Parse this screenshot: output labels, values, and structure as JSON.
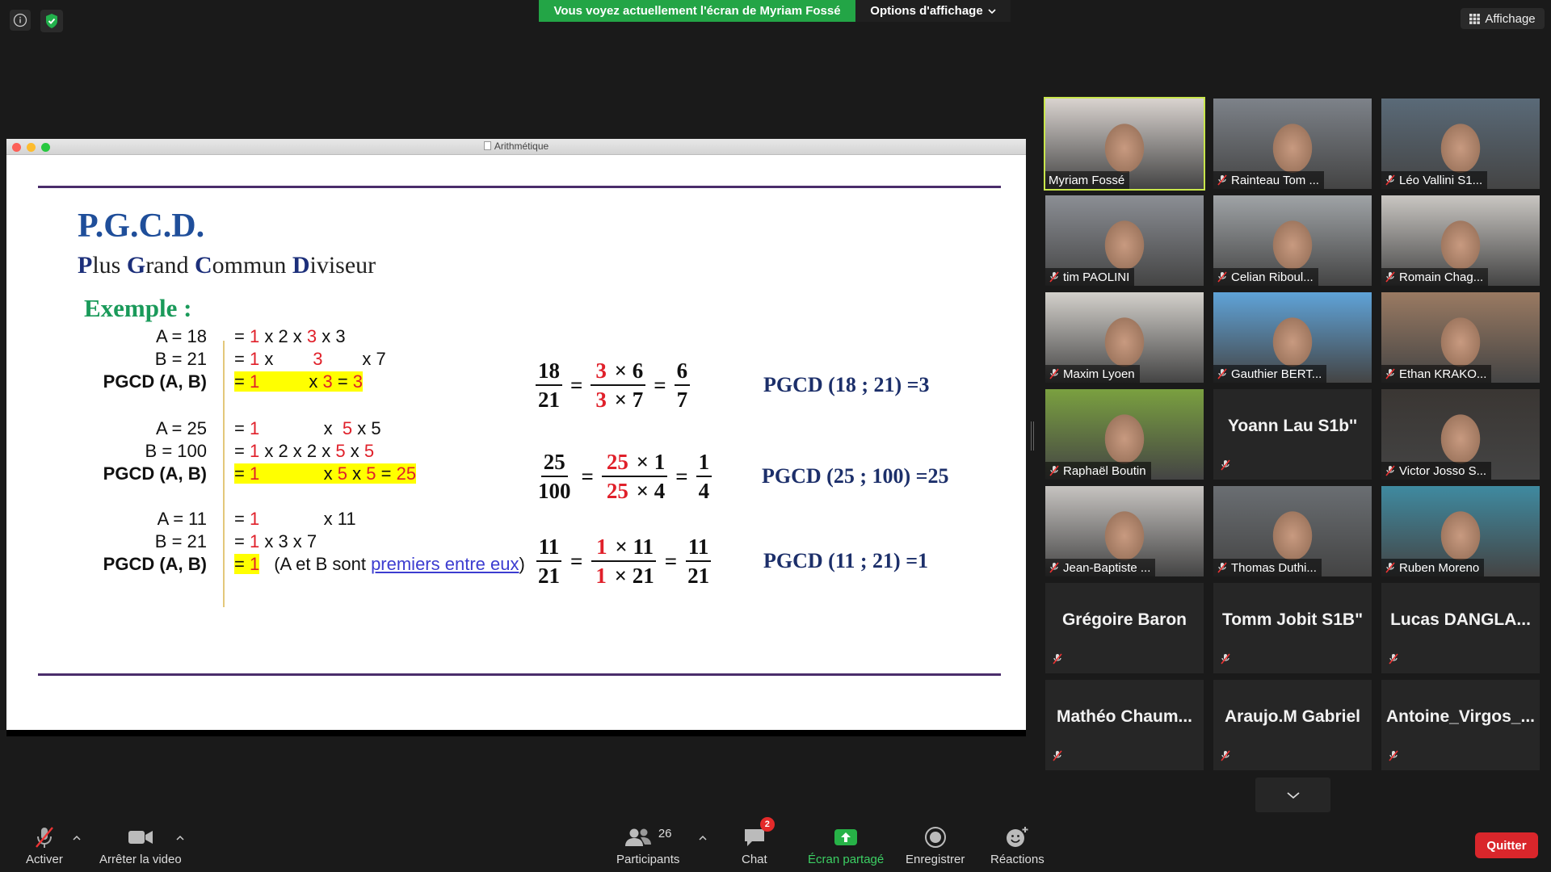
{
  "banner": {
    "text": "Vous voyez actuellement l'écran de Myriam Fossé",
    "options": "Options d'affichage"
  },
  "affichage": "Affichage",
  "window": {
    "title": "Arithmétique"
  },
  "slide": {
    "title": "P.G.C.D.",
    "subtitle": [
      "P",
      "lus ",
      "G",
      "rand ",
      "C",
      "ommun ",
      "D",
      "iviseur"
    ],
    "example": "Exemple :",
    "examples": [
      {
        "rows": [
          {
            "left": "A = 18",
            "mid": [
              [
                "= ",
                ""
              ],
              [
                "1",
                "red"
              ],
              [
                " x 2 x ",
                ""
              ],
              [
                "3",
                "red"
              ],
              [
                " x 3",
                ""
              ]
            ]
          },
          {
            "left": "B = 21",
            "mid": [
              [
                "= ",
                ""
              ],
              [
                "1",
                "red"
              ],
              [
                " x        ",
                ""
              ],
              [
                "3",
                "red"
              ],
              [
                "        x 7",
                ""
              ]
            ]
          },
          {
            "left": "PGCD (A, B)",
            "mid": [
              [
                "= ",
                "hl"
              ],
              [
                "1",
                "hl red"
              ],
              [
                "          x ",
                "hl"
              ],
              [
                "3",
                "hl red"
              ],
              [
                " = ",
                "hl"
              ],
              [
                "3",
                "hl red"
              ]
            ]
          }
        ],
        "frac": [
          [
            "18",
            "21"
          ],
          [
            "3 × 6",
            "3 × 7"
          ],
          [
            "6",
            "7"
          ]
        ],
        "result": "PGCD (18 ; 21) =3"
      },
      {
        "rows": [
          {
            "left": "A = 25",
            "mid": [
              [
                "= ",
                ""
              ],
              [
                "1",
                "red"
              ],
              [
                "             x  ",
                ""
              ],
              [
                "5",
                "red"
              ],
              [
                " x 5",
                ""
              ]
            ]
          },
          {
            "left": "B = 100",
            "mid": [
              [
                "= ",
                ""
              ],
              [
                "1",
                "red"
              ],
              [
                " x 2 x 2 x ",
                ""
              ],
              [
                "5",
                "red"
              ],
              [
                " x ",
                ""
              ],
              [
                "5",
                "red"
              ]
            ]
          },
          {
            "left": "PGCD (A, B)",
            "mid": [
              [
                "= ",
                "hl"
              ],
              [
                "1",
                "hl red"
              ],
              [
                "             x ",
                "hl"
              ],
              [
                "5",
                "hl red"
              ],
              [
                " x ",
                "hl"
              ],
              [
                "5",
                "hl red"
              ],
              [
                " = ",
                "hl"
              ],
              [
                "25",
                "hl red"
              ]
            ]
          }
        ],
        "frac": [
          [
            "25",
            "100"
          ],
          [
            "25 × 1",
            "25 × 4"
          ],
          [
            "1",
            "4"
          ]
        ],
        "result": "PGCD (25 ; 100) =25"
      },
      {
        "rows": [
          {
            "left": "A = 11",
            "mid": [
              [
                "= ",
                ""
              ],
              [
                "1",
                "red"
              ],
              [
                "             x 11",
                ""
              ]
            ]
          },
          {
            "left": "B = 21",
            "mid": [
              [
                "= ",
                ""
              ],
              [
                "1",
                "red"
              ],
              [
                " x 3 x 7",
                ""
              ]
            ]
          },
          {
            "left": "PGCD (A, B)",
            "mid": [
              [
                "= ",
                "hl"
              ],
              [
                "1",
                "hl red"
              ]
            ]
          }
        ],
        "note_pre": "(A et B sont ",
        "note_link": "premiers entre eux",
        "note_post": ")",
        "frac": [
          [
            "11",
            "21"
          ],
          [
            "1 × 11",
            "1 × 21"
          ],
          [
            "11",
            "21"
          ]
        ],
        "result": "PGCD (11 ; 21) =1"
      }
    ]
  },
  "participants": [
    {
      "name": "Myriam Fossé",
      "video": true,
      "active": true,
      "muted": false,
      "bg": "#d9d3cf"
    },
    {
      "name": "Rainteau Tom ...",
      "video": true,
      "muted": true,
      "bg": "#7d8289"
    },
    {
      "name": "Léo Vallini S1...",
      "video": true,
      "muted": true,
      "bg": "#5a6a78"
    },
    {
      "name": "tim PAOLINI",
      "video": true,
      "muted": true,
      "bg": "#8b8e94"
    },
    {
      "name": "Celian Riboul...",
      "video": true,
      "muted": true,
      "bg": "#9fa3a6"
    },
    {
      "name": "Romain Chag...",
      "video": true,
      "muted": true,
      "bg": "#c9c6c2"
    },
    {
      "name": "Maxim Lyoen",
      "video": true,
      "muted": true,
      "bg": "#d3d0cb"
    },
    {
      "name": "Gauthier BERT...",
      "video": true,
      "muted": true,
      "bg": "#5fa3d8"
    },
    {
      "name": "Ethan KRAKO...",
      "video": true,
      "muted": true,
      "bg": "#9a7a62"
    },
    {
      "name": "Raphaël Boutin",
      "video": true,
      "muted": true,
      "bg": "#7aa040"
    },
    {
      "name": "Yoann Lau S1b''",
      "video": false,
      "muted": true
    },
    {
      "name": "Victor Josso S...",
      "video": true,
      "muted": true,
      "bg": "#3a3633"
    },
    {
      "name": "Jean-Baptiste ...",
      "video": true,
      "muted": true,
      "bg": "#c6c3c0"
    },
    {
      "name": "Thomas Duthi...",
      "video": true,
      "muted": true,
      "bg": "#6a6e72"
    },
    {
      "name": "Ruben Moreno",
      "video": true,
      "muted": true,
      "bg": "#3f8aa0"
    },
    {
      "name": "Grégoire Baron",
      "video": false,
      "muted": true
    },
    {
      "name": "Tomm Jobit S1B\"",
      "video": false,
      "muted": true
    },
    {
      "name": "Lucas  DANGLA...",
      "video": false,
      "muted": true
    },
    {
      "name": "Mathéo  Chaum...",
      "video": false,
      "muted": true
    },
    {
      "name": "Araujo.M Gabriel",
      "video": false,
      "muted": true
    },
    {
      "name": "Antoine_Virgos_...",
      "video": false,
      "muted": true
    }
  ],
  "toolbar": {
    "activer": "Activer",
    "video": "Arrêter la video",
    "participants": "Participants",
    "participants_count": "26",
    "chat": "Chat",
    "chat_badge": "2",
    "share": "Écran partagé",
    "record": "Enregistrer",
    "reactions": "Réactions",
    "quit": "Quitter"
  }
}
